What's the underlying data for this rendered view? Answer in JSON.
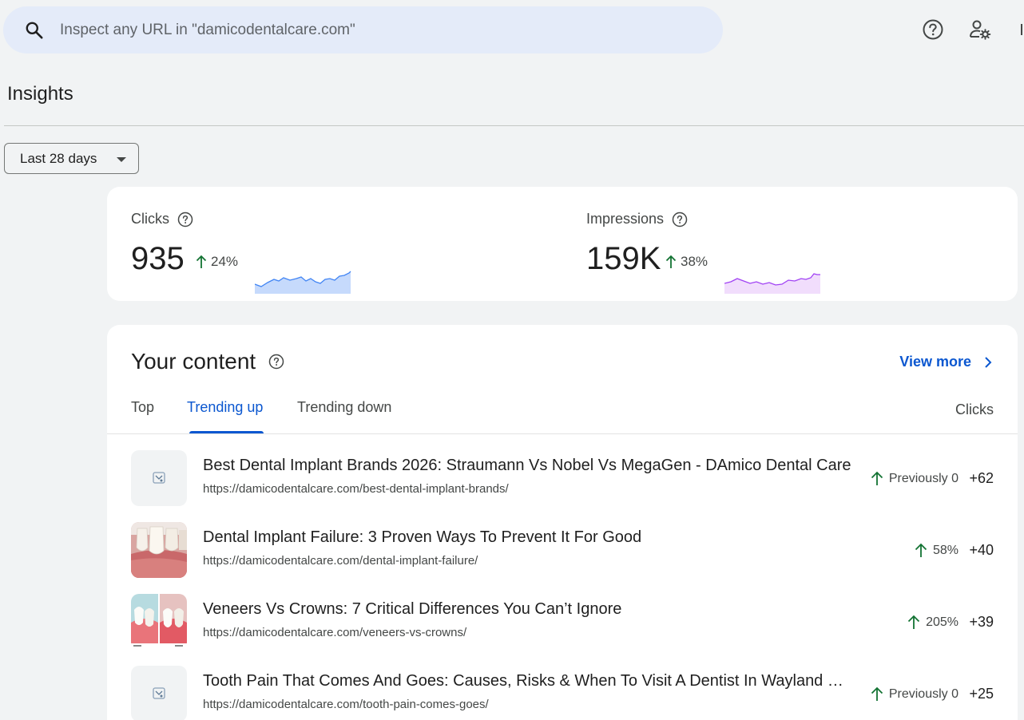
{
  "search": {
    "placeholder": "Inspect any URL in \"damicodentalcare.com\"",
    "value": ""
  },
  "header_icons": [
    "help-icon",
    "admin-settings-icon",
    "notifications-icon"
  ],
  "page_title": "Insights",
  "date_filter": {
    "selected": "Last 28 days"
  },
  "metrics": {
    "clicks": {
      "label": "Clicks",
      "value": "935",
      "change": "24%",
      "trend": "up",
      "color": "#4285f4"
    },
    "impressions": {
      "label": "Impressions",
      "value": "159K",
      "change": "38%",
      "trend": "up",
      "color": "#a142f4"
    }
  },
  "content": {
    "title": "Your content",
    "view_more": "View more",
    "tabs": [
      {
        "label": "Top",
        "active": false
      },
      {
        "label": "Trending up",
        "active": true
      },
      {
        "label": "Trending down",
        "active": false
      }
    ],
    "column_header": "Clicks",
    "rows": [
      {
        "title": "Best Dental Implant Brands 2026: Straumann Vs Nobel Vs MegaGen - DAmico Dental Care",
        "url": "https://damicodentalcare.com/best-dental-implant-brands/",
        "change": "Previously 0",
        "clicks": "+62",
        "thumb": "site-logo"
      },
      {
        "title": "Dental Implant Failure: 3 Proven Ways To Prevent It For Good",
        "url": "https://damicodentalcare.com/dental-implant-failure/",
        "change": "58%",
        "clicks": "+40",
        "thumb": "teeth-photo"
      },
      {
        "title": "Veneers Vs Crowns: 7 Critical Differences You Can’t Ignore",
        "url": "https://damicodentalcare.com/veneers-vs-crowns/",
        "change": "205%",
        "clicks": "+39",
        "thumb": "veneers-photo"
      },
      {
        "title": "Tooth Pain That Comes And Goes: Causes, Risks & When To Visit A Dentist In Wayland Or...",
        "url": "https://damicodentalcare.com/tooth-pain-comes-goes/",
        "change": "Previously 0",
        "clicks": "+25",
        "thumb": "site-logo"
      }
    ]
  },
  "colors": {
    "accent": "#0b57d0",
    "trend_up": "#137333"
  }
}
